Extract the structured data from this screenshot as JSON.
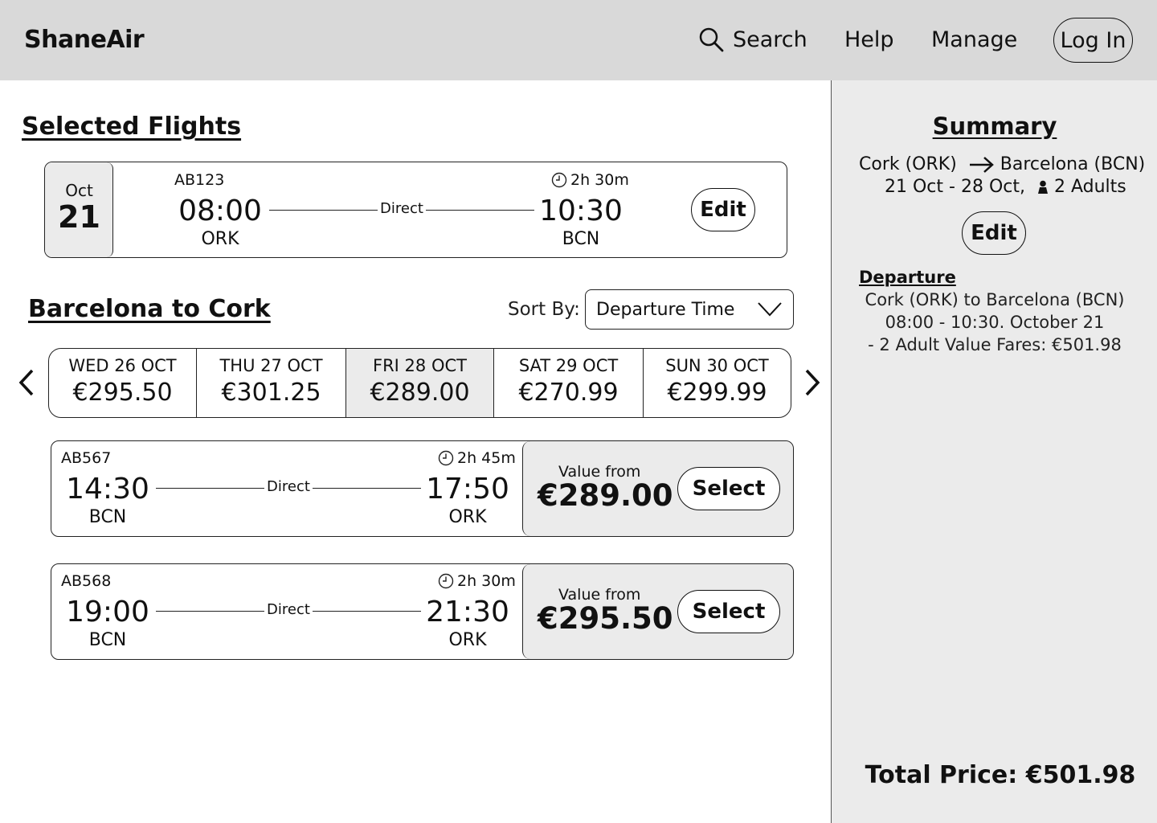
{
  "header": {
    "logo": "ShaneAir",
    "nav": {
      "search": "Search",
      "help": "Help",
      "manage": "Manage",
      "login": "Log In"
    }
  },
  "selected": {
    "title": "Selected Flights",
    "flight": {
      "month": "Oct",
      "day": "21",
      "number": "AB123",
      "duration": "2h 30m",
      "depart_time": "08:00",
      "depart_code": "ORK",
      "arrive_time": "10:30",
      "arrive_code": "BCN",
      "stops": "Direct",
      "edit_label": "Edit"
    }
  },
  "return_section": {
    "title": "Barcelona to Cork",
    "sort_label": "Sort By:",
    "sort_value": "Departure Time"
  },
  "dates": [
    {
      "label": "WED 26 OCT",
      "price": "€295.50",
      "selected": false
    },
    {
      "label": "THU 27 OCT",
      "price": "€301.25",
      "selected": false
    },
    {
      "label": "FRI 28 OCT",
      "price": "€289.00",
      "selected": true
    },
    {
      "label": "SAT 29 OCT",
      "price": "€270.99",
      "selected": false
    },
    {
      "label": "SUN 30 OCT",
      "price": "€299.99",
      "selected": false
    }
  ],
  "results": [
    {
      "number": "AB567",
      "duration": "2h 45m",
      "depart_time": "14:30",
      "depart_code": "BCN",
      "arrive_time": "17:50",
      "arrive_code": "ORK",
      "stops": "Direct",
      "value_from": "Value from",
      "price": "€289.00",
      "select_label": "Select"
    },
    {
      "number": "AB568",
      "duration": "2h 30m",
      "depart_time": "19:00",
      "depart_code": "BCN",
      "arrive_time": "21:30",
      "arrive_code": "ORK",
      "stops": "Direct",
      "value_from": "Value from",
      "price": "€295.50",
      "select_label": "Select"
    }
  ],
  "summary": {
    "title": "Summary",
    "from": "Cork (ORK)",
    "to": "Barcelona (BCN)",
    "dates": "21 Oct - 28 Oct,",
    "passengers": "2 Adults",
    "edit_label": "Edit",
    "departure_heading": "Departure",
    "departure_lines": [
      "Cork (ORK) to Barcelona (BCN)",
      "08:00 - 10:30. October 21",
      "- 2 Adult Value Fares: €501.98"
    ],
    "total": "Total Price: €501.98"
  }
}
